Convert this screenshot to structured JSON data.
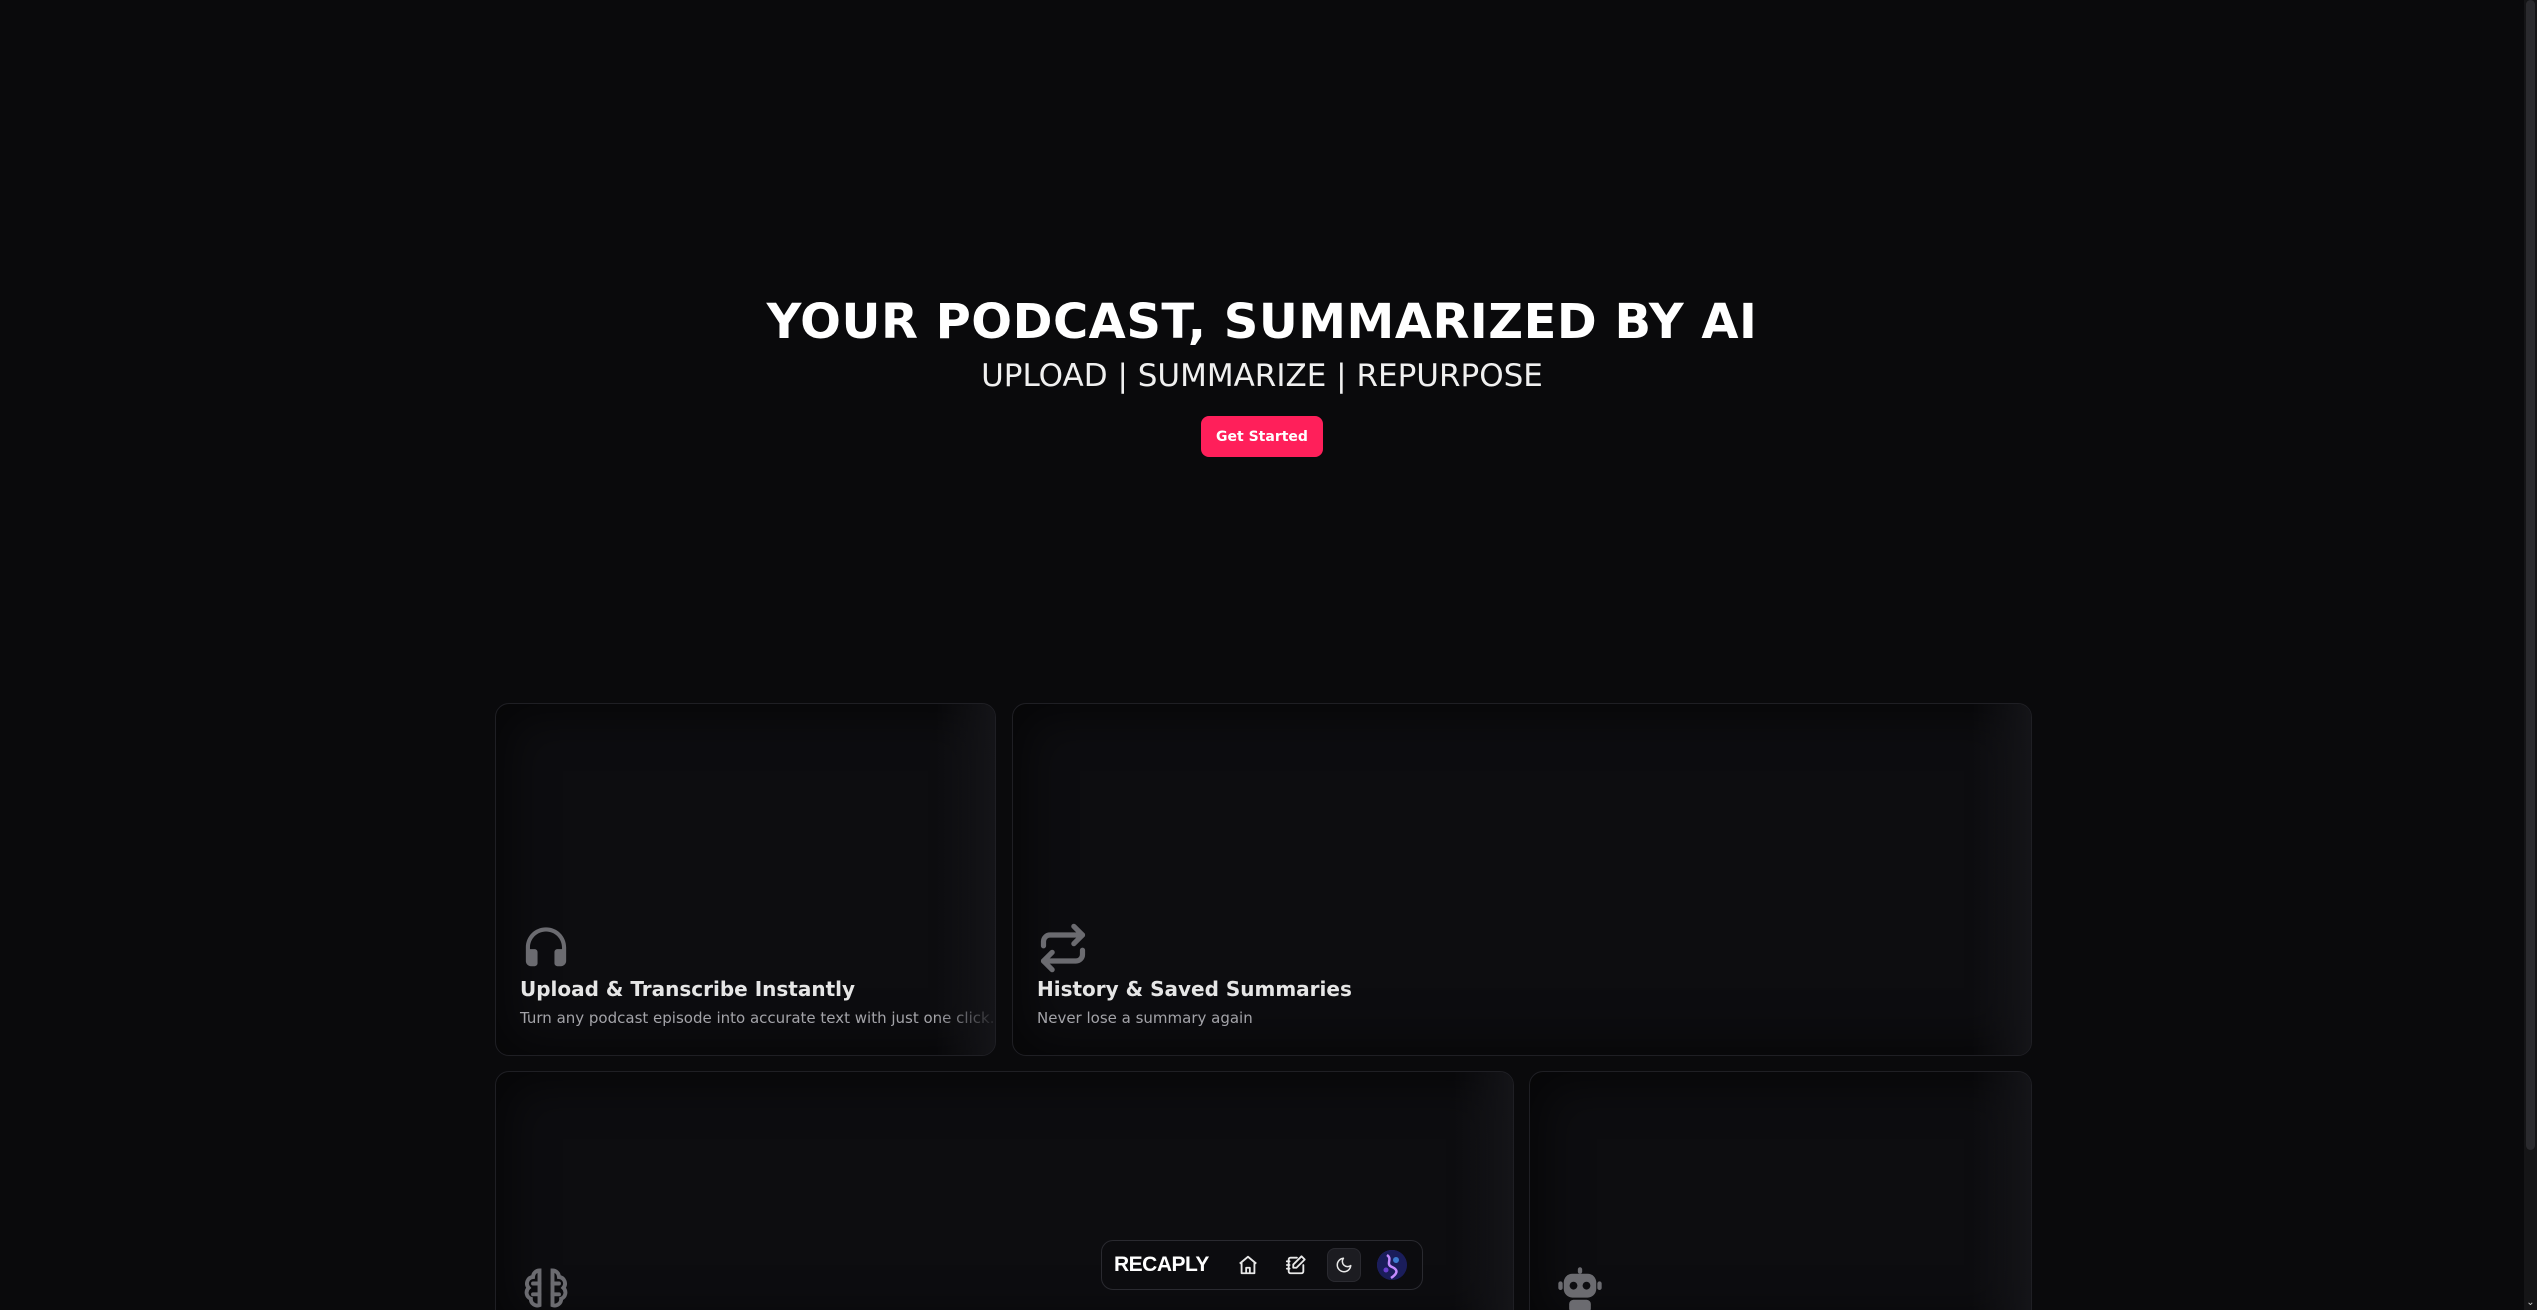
{
  "hero": {
    "title": "YOUR PODCAST, SUMMARIZED BY AI",
    "subtitle": "UPLOAD | SUMMARIZE | REPURPOSE",
    "cta_label": "Get Started"
  },
  "cards": [
    {
      "icon": "headphones-icon",
      "title": "Upload & Transcribe Instantly",
      "description": "Turn any podcast episode into accurate text with just one click."
    },
    {
      "icon": "repeat-icon",
      "title": "History & Saved Summaries",
      "description": "Never lose a summary again"
    },
    {
      "icon": "brain-icon",
      "title": "",
      "description": ""
    },
    {
      "icon": "robot-icon",
      "title": "",
      "description": ""
    }
  ],
  "dock": {
    "brand": "RECAPLY",
    "items": [
      {
        "icon": "home-icon"
      },
      {
        "icon": "edit-icon"
      },
      {
        "icon": "moon-icon"
      },
      {
        "icon": "avatar"
      }
    ]
  },
  "colors": {
    "background": "#0a0a0c",
    "accent": "#ff1f5a",
    "card_border": "#1f1f24",
    "muted_text": "#a3a3a8"
  }
}
